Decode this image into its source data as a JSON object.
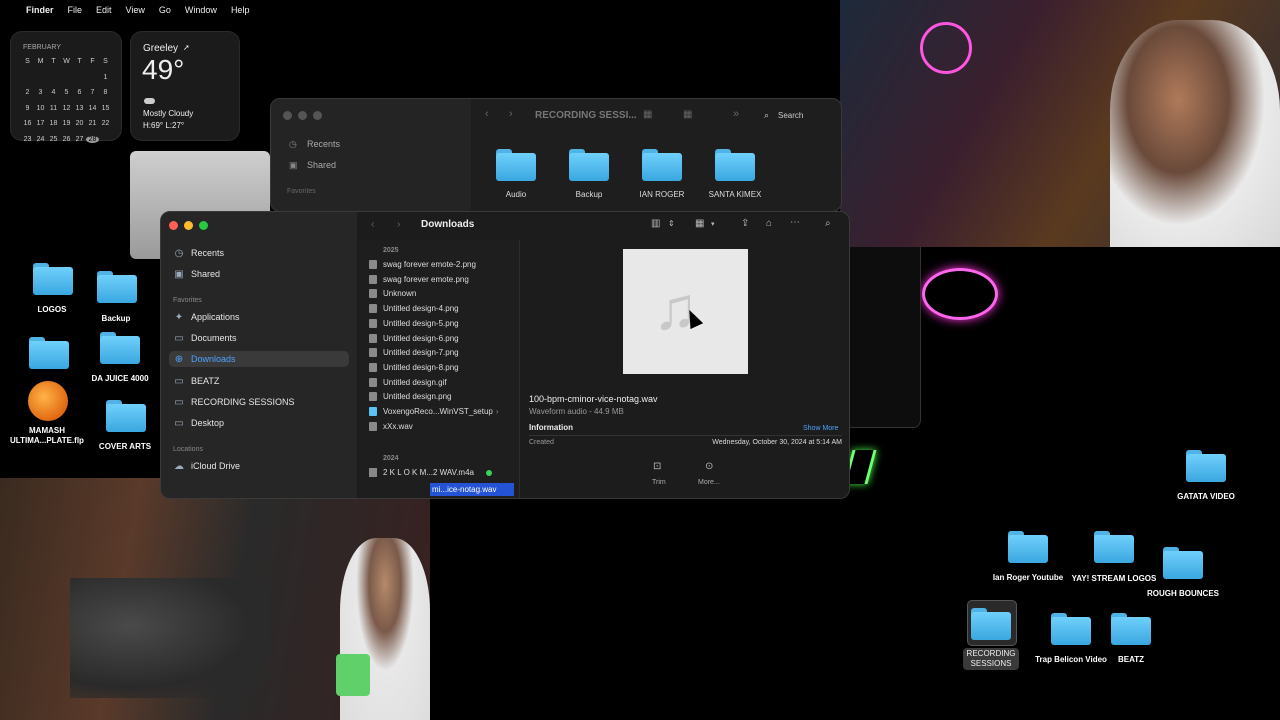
{
  "menubar": {
    "apple": "",
    "items": [
      "Finder",
      "File",
      "Edit",
      "View",
      "Go",
      "Window",
      "Help"
    ]
  },
  "calendar": {
    "month": "FEBRUARY",
    "weekdays": [
      "S",
      "M",
      "T",
      "W",
      "T",
      "F",
      "S"
    ],
    "weeks": [
      [
        "",
        "",
        "",
        "",
        "",
        "",
        "1"
      ],
      [
        "2",
        "3",
        "4",
        "5",
        "6",
        "7",
        "8"
      ],
      [
        "9",
        "10",
        "11",
        "12",
        "13",
        "14",
        "15"
      ],
      [
        "16",
        "17",
        "18",
        "19",
        "20",
        "21",
        "22"
      ],
      [
        "23",
        "24",
        "25",
        "26",
        "27",
        "28",
        ""
      ]
    ],
    "today": "28"
  },
  "weather": {
    "city": "Greeley",
    "temp": "49°",
    "condition": "Mostly Cloudy",
    "hilo": "H:69° L:27°"
  },
  "back_finder": {
    "title": "RECORDING SESSI...",
    "search": "Search",
    "sidebar": [
      "Recents",
      "Shared",
      "Favorites",
      "Applications"
    ],
    "folders": [
      "Audio",
      "Backup",
      "IAN ROGER",
      "SANTA KIMEX"
    ]
  },
  "finder": {
    "title": "Downloads",
    "sidebar": {
      "recents": "Recents",
      "shared": "Shared",
      "favorites_header": "Favorites",
      "items": [
        "Applications",
        "Documents",
        "Downloads",
        "BEATZ",
        "RECORDING SESSIONS",
        "Desktop"
      ],
      "locations_header": "Locations",
      "icloud": "iCloud Drive"
    },
    "year_2025": "2025",
    "files": [
      "swag forever emote-2.png",
      "swag forever emote.png",
      "Unknown",
      "Untitled design-4.png",
      "Untitled design-5.png",
      "Untitled design-6.png",
      "Untitled design-7.png",
      "Untitled design-8.png",
      "Untitled design.gif",
      "Untitled design.png",
      "VoxengoReco...WinVST_setup",
      "xXx.wav"
    ],
    "year_2024": "2024",
    "files_2024": [
      "2 K L O K M...2 WAV.m4a",
      "mi...ice-notag.wav"
    ],
    "preview": {
      "filename": "100-bpm-cminor-vice-notag.wav",
      "kind": "Waveform audio - 44.9 MB",
      "info_label": "Information",
      "show_more": "Show More",
      "created_label": "Created",
      "created_value": "Wednesday, October 30, 2024 at 5:14 AM",
      "trim": "Trim",
      "more": "More..."
    }
  },
  "desktop_icons": {
    "logos": "LOGOS",
    "backup": "Backup",
    "da_juice": "DA JUICE 4000",
    "mamash": "MAMASH ULTIMA...PLATE.flp",
    "cover_arts": "COVER ARTS",
    "gatata": "GATATA VIDEO",
    "ian_roger": "Ian Roger Youtube",
    "yay": "YAY! STREAM LOGOS",
    "rough": "ROUGH BOUNCES",
    "recording": "RECORDING SESSIONS",
    "trap": "Trap Belicon Video",
    "beatz": "BEATZ"
  },
  "colors": {
    "accent": "#4da3ff",
    "folder": "#5cc1f5",
    "selection": "#2553d6"
  }
}
